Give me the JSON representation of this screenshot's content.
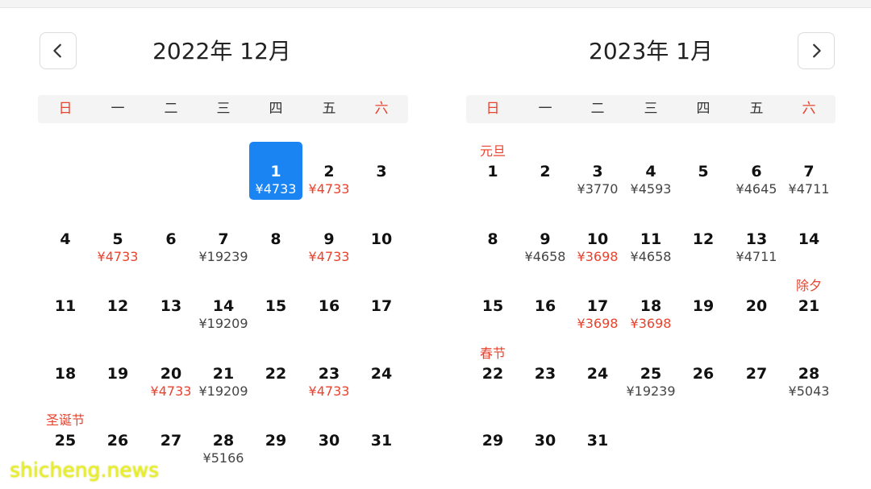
{
  "weekdays": [
    "日",
    "一",
    "二",
    "三",
    "四",
    "五",
    "六"
  ],
  "colors": {
    "accent": "#1a84f2",
    "holiday_red": "#e8432e",
    "price_gray": "#444444"
  },
  "icons": {
    "prev": "chevron-left-icon",
    "next": "chevron-right-icon"
  },
  "months": [
    {
      "title": "2022年 12月",
      "days": [
        {
          "day": "1",
          "price": "¥4733",
          "low": true,
          "selected": true
        },
        {
          "day": "2",
          "price": "¥4733",
          "low": true
        },
        {
          "day": "3"
        },
        {
          "day": "4"
        },
        {
          "day": "5",
          "price": "¥4733",
          "low": true
        },
        {
          "day": "6"
        },
        {
          "day": "7",
          "price": "¥19239"
        },
        {
          "day": "8"
        },
        {
          "day": "9",
          "price": "¥4733",
          "low": true
        },
        {
          "day": "10"
        },
        {
          "day": "11"
        },
        {
          "day": "12"
        },
        {
          "day": "13"
        },
        {
          "day": "14",
          "price": "¥19209"
        },
        {
          "day": "15"
        },
        {
          "day": "16"
        },
        {
          "day": "17"
        },
        {
          "day": "18"
        },
        {
          "day": "19"
        },
        {
          "day": "20",
          "price": "¥4733",
          "low": true
        },
        {
          "day": "21",
          "price": "¥19209"
        },
        {
          "day": "22"
        },
        {
          "day": "23",
          "price": "¥4733",
          "low": true
        },
        {
          "day": "24"
        },
        {
          "day": "25",
          "holiday": "圣诞节"
        },
        {
          "day": "26"
        },
        {
          "day": "27"
        },
        {
          "day": "28",
          "price": "¥5166"
        },
        {
          "day": "29"
        },
        {
          "day": "30"
        },
        {
          "day": "31"
        }
      ]
    },
    {
      "title": "2023年 1月",
      "days": [
        {
          "day": "1",
          "holiday": "元旦"
        },
        {
          "day": "2"
        },
        {
          "day": "3",
          "price": "¥3770"
        },
        {
          "day": "4",
          "price": "¥4593"
        },
        {
          "day": "5"
        },
        {
          "day": "6",
          "price": "¥4645"
        },
        {
          "day": "7",
          "price": "¥4711"
        },
        {
          "day": "8"
        },
        {
          "day": "9",
          "price": "¥4658"
        },
        {
          "day": "10",
          "price": "¥3698",
          "low": true
        },
        {
          "day": "11",
          "price": "¥4658"
        },
        {
          "day": "12"
        },
        {
          "day": "13",
          "price": "¥4711"
        },
        {
          "day": "14"
        },
        {
          "day": "15"
        },
        {
          "day": "16"
        },
        {
          "day": "17",
          "price": "¥3698",
          "low": true
        },
        {
          "day": "18",
          "price": "¥3698",
          "low": true
        },
        {
          "day": "19"
        },
        {
          "day": "20"
        },
        {
          "day": "21",
          "holiday": "除夕"
        },
        {
          "day": "22",
          "holiday": "春节"
        },
        {
          "day": "23"
        },
        {
          "day": "24"
        },
        {
          "day": "25",
          "price": "¥19239"
        },
        {
          "day": "26"
        },
        {
          "day": "27"
        },
        {
          "day": "28",
          "price": "¥5043"
        },
        {
          "day": "29"
        },
        {
          "day": "30"
        },
        {
          "day": "31"
        }
      ]
    }
  ],
  "watermark": "shicheng.news"
}
